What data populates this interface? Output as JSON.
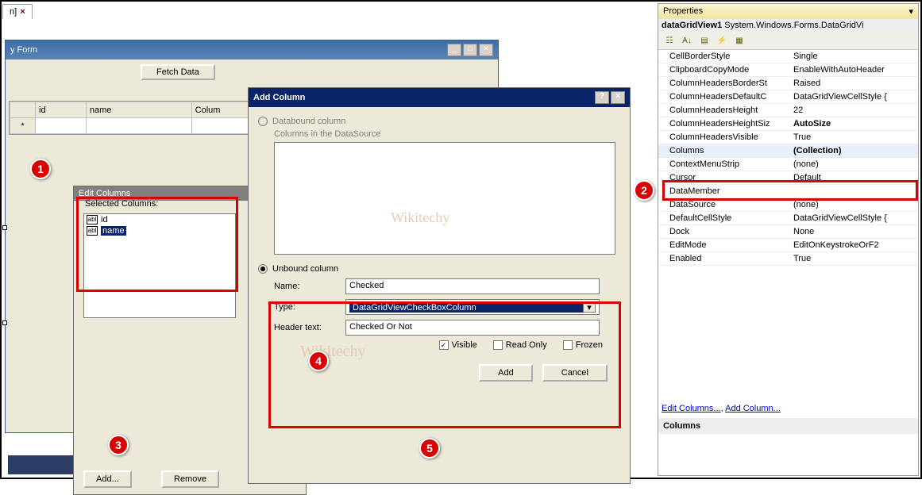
{
  "tab": {
    "label": "n]",
    "close": "×"
  },
  "form": {
    "title": "y Form",
    "fetch": "Fetch Data",
    "grid_cols": [
      "id",
      "name",
      "Colum"
    ],
    "new_row_marker": "*"
  },
  "edit": {
    "title": "Edit Columns",
    "sel_label": "Selected Columns:",
    "items": [
      "id",
      "name"
    ],
    "add": "Add...",
    "remove": "Remove"
  },
  "addcol": {
    "title": "Add Column",
    "help": "?",
    "close": "×",
    "databound": "Databound column",
    "ds_label": "Columns in the DataSource",
    "unbound": "Unbound column",
    "name_label": "Name:",
    "name_value": "Checked",
    "type_label": "Type:",
    "type_value": "DataGridViewCheckBoxColumn",
    "header_label": "Header text:",
    "header_value": "Checked Or Not",
    "visible": "Visible",
    "readonly": "Read Only",
    "frozen": "Frozen",
    "add": "Add",
    "cancel": "Cancel"
  },
  "props": {
    "title": "Properties",
    "pin": "▾",
    "object": "dataGridView1",
    "object_type": "System.Windows.Forms.DataGridVi",
    "rows": [
      {
        "k": "CellBorderStyle",
        "v": "Single"
      },
      {
        "k": "ClipboardCopyMode",
        "v": "EnableWithAutoHeader"
      },
      {
        "k": "ColumnHeadersBorderSt",
        "v": "Raised"
      },
      {
        "k": "ColumnHeadersDefaultC",
        "v": "DataGridViewCellStyle {"
      },
      {
        "k": "ColumnHeadersHeight",
        "v": "22"
      },
      {
        "k": "ColumnHeadersHeightSiz",
        "v": "AutoSize",
        "bold": true
      },
      {
        "k": "ColumnHeadersVisible",
        "v": "True"
      },
      {
        "k": "Columns",
        "v": "(Collection)"
      },
      {
        "k": "ContextMenuStrip",
        "v": "(none)"
      },
      {
        "k": "Cursor",
        "v": "Default"
      },
      {
        "k": "DataMember",
        "v": ""
      },
      {
        "k": "DataSource",
        "v": "(none)"
      },
      {
        "k": "DefaultCellStyle",
        "v": "DataGridViewCellStyle {"
      },
      {
        "k": "Dock",
        "v": "None"
      },
      {
        "k": "EditMode",
        "v": "EditOnKeystrokeOrF2"
      },
      {
        "k": "Enabled",
        "v": "True"
      }
    ],
    "link_edit": "Edit Columns...",
    "link_add": "Add Column...",
    "foot": "Columns"
  },
  "watermark1": "Wikitechy",
  "watermark2": "Wikitechy"
}
